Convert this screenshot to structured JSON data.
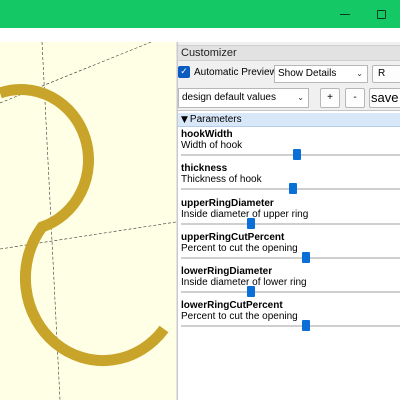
{
  "window": {
    "minimize_icon": "minimize-icon",
    "maximize_icon": "maximize-icon"
  },
  "viewport": {
    "model_color": "#c8a42a",
    "background": "#ffffe6"
  },
  "customizer": {
    "title": "Customizer",
    "automatic_preview": {
      "label": "Automatic Preview",
      "checked": true
    },
    "details_select": "Show Details",
    "reset_button": "R",
    "preset_select": "design default values",
    "plus_button": "+",
    "minus_button": "-",
    "save_button": "save",
    "parameters_header": "Parameters",
    "parameters": [
      {
        "name": "hookWidth",
        "description": "Width of hook",
        "value_fraction": 0.53
      },
      {
        "name": "thickness",
        "description": "Thickness of hook",
        "value_fraction": 0.51
      },
      {
        "name": "upperRingDiameter",
        "description": "Inside diameter of upper ring",
        "value_fraction": 0.32
      },
      {
        "name": "upperRingCutPercent",
        "description": "Percent to cut the opening",
        "value_fraction": 0.57
      },
      {
        "name": "lowerRingDiameter",
        "description": "Inside diameter of lower ring",
        "value_fraction": 0.32
      },
      {
        "name": "lowerRingCutPercent",
        "description": "Percent to cut the opening",
        "value_fraction": 0.57
      }
    ]
  }
}
